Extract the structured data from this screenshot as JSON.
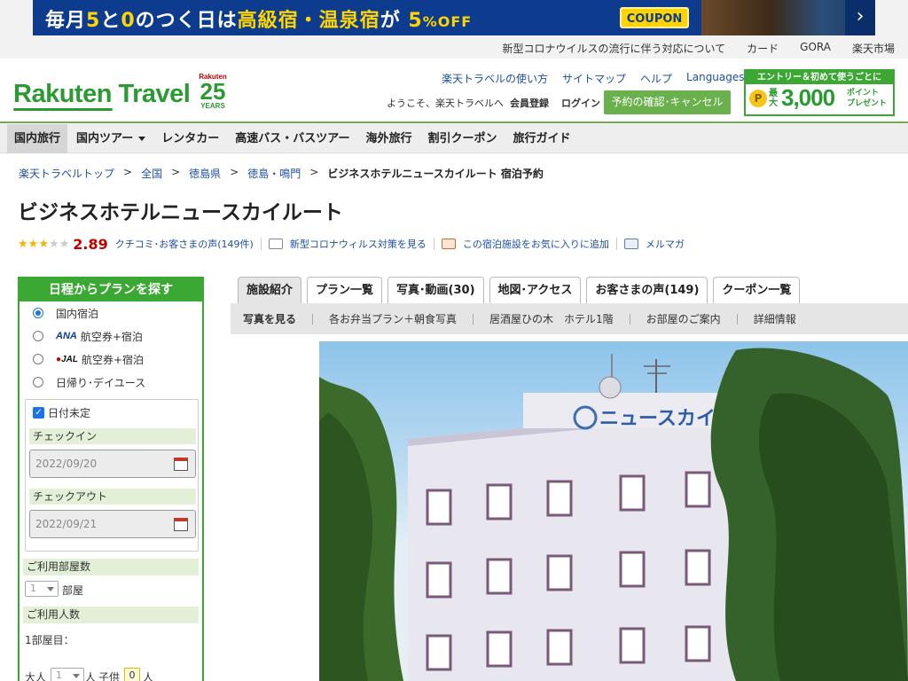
{
  "banner": {
    "text_a": "毎月",
    "text_b": "5",
    "text_c": "と",
    "text_d": "0",
    "text_e": "のつく日は",
    "text_f": "高級宿・温泉宿",
    "text_g": "が",
    "text_h": "5",
    "text_i": "%OFF",
    "coupon": "COUPON",
    "arrow": "›"
  },
  "util_links": [
    "新型コロナウイルスの流行に伴う対応について",
    "カード",
    "GORA",
    "楽天市場"
  ],
  "header": {
    "logo": "Rakuten Travel",
    "anniv_top": "Rakuten",
    "anniv_num": "25",
    "anniv_bottom": "YEARS",
    "links": [
      "楽天トラベルの使い方",
      "サイトマップ",
      "ヘルプ"
    ],
    "languages": "Languages",
    "welcome": "ようこそ、楽天トラベルへ",
    "member_reg": "会員登録",
    "login": "ログイン",
    "reserve_button": "予約の確認･キャンセル",
    "promo_top": "エントリー＆初めて使うごとに",
    "promo_coin": "P",
    "promo_max": "最大",
    "promo_num": "3,000",
    "promo_pt1": "ポイント",
    "promo_pt2": "プレゼント"
  },
  "gnav": [
    "国内旅行",
    "国内ツアー",
    "レンタカー",
    "高速バス・バスツアー",
    "海外旅行",
    "割引クーポン",
    "旅行ガイド"
  ],
  "breadcrumb": {
    "links": [
      "楽天トラベルトップ",
      "全国",
      "徳島県",
      "徳島・鳴門"
    ],
    "sep": ">",
    "current": "ビジネスホテルニュースカイルート 宿泊予約"
  },
  "hotel": {
    "name": "ビジネスホテルニュースカイルート",
    "rating": 2.89,
    "rating_text": "2.89",
    "stars_filled": 3,
    "stars_total": 5,
    "reviews_link": "クチコミ･お客さまの声(149件)",
    "covid_link": "新型コロナウィルス対策を見る",
    "fav_link": "この宿泊施設をお気に入りに追加",
    "mail_link": "メルマガ"
  },
  "sidebar": {
    "title": "日程からプランを探す",
    "options": [
      {
        "label": "国内宿泊",
        "selected": true,
        "airline": ""
      },
      {
        "label": "航空券+宿泊",
        "selected": false,
        "airline": "ANA"
      },
      {
        "label": "航空券+宿泊",
        "selected": false,
        "airline": "JAL"
      },
      {
        "label": "日帰り･デイユース",
        "selected": false,
        "airline": ""
      }
    ],
    "undecided_label": "日付未定",
    "checkin_label": "チェックイン",
    "checkin_value": "2022/09/20",
    "checkout_label": "チェックアウト",
    "checkout_value": "2022/09/21",
    "rooms_label": "ご利用部屋数",
    "rooms_value": "1",
    "rooms_unit": "部屋",
    "guests_label": "ご利用人数",
    "room1_label": "1部屋目：",
    "adult_label": "大人",
    "adult_value": "1",
    "person_unit": "人",
    "child_label": "子供",
    "child_value": "0"
  },
  "tabs": [
    "施設紹介",
    "プラン一覧",
    "写真･動画(30)",
    "地図･アクセス",
    "お客さまの声(149)",
    "クーポン一覧"
  ],
  "subnav": [
    "写真を見る",
    "各お弁当プラン＋朝食写真",
    "居酒屋ひの木　ホテル1階",
    "お部屋のご案内",
    "詳細情報"
  ],
  "photo": {
    "sign_text": "ニュースカイ"
  },
  "colors": {
    "brand_green": "#3aa832",
    "link_blue": "#1d50a2",
    "rating_red": "#bf0000",
    "banner_navy": "#0d3c8f"
  }
}
